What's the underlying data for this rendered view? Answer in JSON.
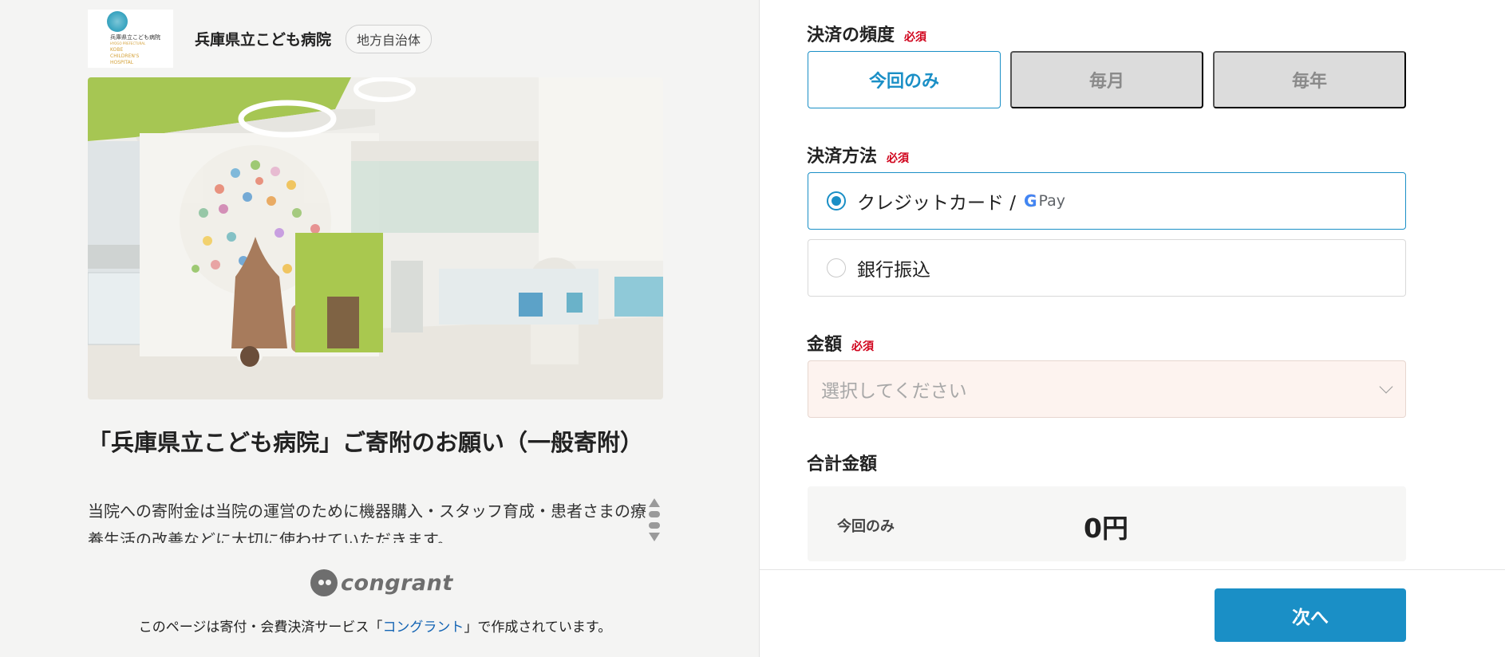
{
  "org": {
    "logo_line1": "兵庫県立こども病院",
    "logo_line2": "HYOGO PREFECTURAL",
    "logo_line3": "KOBE\nCHILDREN'S\nHOSPITAL",
    "name": "兵庫県立こども病院",
    "badge": "地方自治体"
  },
  "project": {
    "title": "「兵庫県立こども病院」ご寄附のお願い（一般寄附）",
    "description": "当院への寄附金は当院の運営のために機器購入・スタッフ育成・患者さまの療養生活の改善などに大切に使わせていただきます。"
  },
  "footer": {
    "brand": "congrant",
    "note_before": "このページは寄付・会費決済サービス「",
    "note_link": "コングラント",
    "note_after": "」で作成されています。"
  },
  "form": {
    "required_label": "必須",
    "frequency": {
      "label": "決済の頻度",
      "options": [
        {
          "label": "今回のみ",
          "active": true
        },
        {
          "label": "毎月",
          "active": false
        },
        {
          "label": "毎年",
          "active": false
        }
      ]
    },
    "method": {
      "label": "決済方法",
      "options": [
        {
          "label": "クレジットカード /",
          "extra": "Pay",
          "selected": true
        },
        {
          "label": "銀行振込",
          "selected": false
        }
      ]
    },
    "amount": {
      "label": "金額",
      "placeholder": "選択してください"
    },
    "total": {
      "label": "合計金額",
      "row_label": "今回のみ",
      "value": "0円"
    },
    "next_button": "次へ"
  },
  "colors": {
    "accent": "#1a8fc6",
    "required": "#d0021b",
    "link": "#1565b4"
  }
}
